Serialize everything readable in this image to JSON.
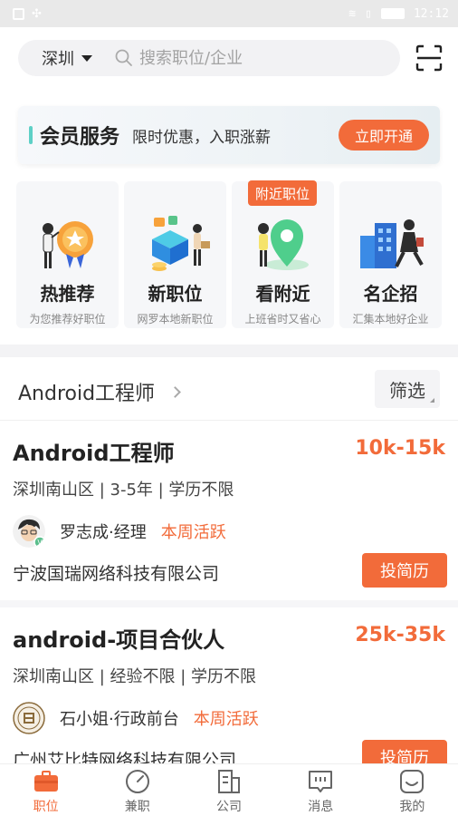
{
  "status_bar": {
    "time": "12:12"
  },
  "search": {
    "city": "深圳",
    "placeholder": "搜索职位/企业"
  },
  "vip": {
    "title": "会员服务",
    "subtitle": "限时优惠，入职涨薪",
    "button": "立即开通"
  },
  "categories": [
    {
      "title": "热推荐",
      "subtitle": "为您推荐好职位",
      "icon": "trophy-illustration"
    },
    {
      "title": "新职位",
      "subtitle": "网罗本地新职位",
      "icon": "new-jobs-illustration"
    },
    {
      "title": "看附近",
      "subtitle": "上班省时又省心",
      "icon": "map-pin-illustration",
      "badge": "附近职位"
    },
    {
      "title": "名企招",
      "subtitle": "汇集本地好企业",
      "icon": "buildings-illustration"
    }
  ],
  "filter": {
    "keyword": "Android工程师",
    "filter_label": "筛选"
  },
  "jobs": [
    {
      "title": "Android工程师",
      "salary": "10k-15k",
      "meta": "深圳南山区 | 3-5年 | 学历不限",
      "recruiter": "罗志成·经理",
      "active": "本周活跃",
      "company": "宁波国瑞网络科技有限公司",
      "apply": "投简历"
    },
    {
      "title": "android-项目合伙人",
      "salary": "25k-35k",
      "meta": "深圳南山区 | 经验不限 | 学历不限",
      "recruiter": "石小姐·行政前台",
      "active": "本周活跃",
      "company": "广州艾比特网络科技有限公司",
      "apply": "投简历"
    }
  ],
  "tabs": [
    {
      "label": "职位",
      "icon": "briefcase-icon",
      "active": true
    },
    {
      "label": "兼职",
      "icon": "compass-icon",
      "active": false
    },
    {
      "label": "公司",
      "icon": "building-icon",
      "active": false
    },
    {
      "label": "消息",
      "icon": "message-icon",
      "active": false
    },
    {
      "label": "我的",
      "icon": "profile-icon",
      "active": false
    }
  ],
  "colors": {
    "accent": "#f26b3a",
    "vip_bar": "#5ed0c6",
    "tab_active": "#f26b3a"
  }
}
